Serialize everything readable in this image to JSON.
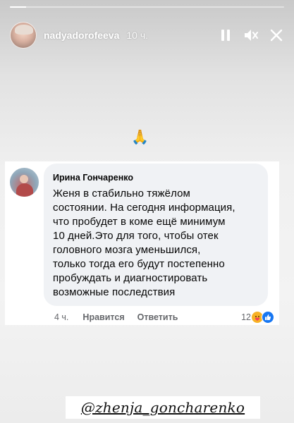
{
  "story": {
    "progress": 0.06,
    "username": "nadyadorofeeva",
    "time_ago": "10 ч.",
    "controls": {
      "pause_icon": "pause-icon",
      "mute_icon": "mute-icon",
      "close_icon": "close-icon"
    }
  },
  "emoji": {
    "glyph": "🙏",
    "icon": "folded-hands-icon"
  },
  "comment": {
    "author": "Ирина Гончаренко",
    "text": "Женя в стабильно тяжёлом\nсостоянии. На сегодня информация,\nчто пробудет в коме ещё минимум\n10 дней.Это для того, чтобы отек\nголовного мозга уменьшился,\nтолько тогда его будут постепенно\nпробуждать и диагностировать\nвозможные последствия",
    "age": "4 ч.",
    "like_label": "Нравится",
    "reply_label": "Ответить",
    "reaction_count": "12",
    "reactions": [
      "care-reaction-icon",
      "like-reaction-icon"
    ]
  },
  "mention": {
    "text": "@zhenja_goncharenko"
  },
  "colors": {
    "bubble": "#f0f2f5",
    "like_blue": "#1877f2",
    "care_yellow": "#f7b125",
    "meta_gray": "#65676b"
  }
}
